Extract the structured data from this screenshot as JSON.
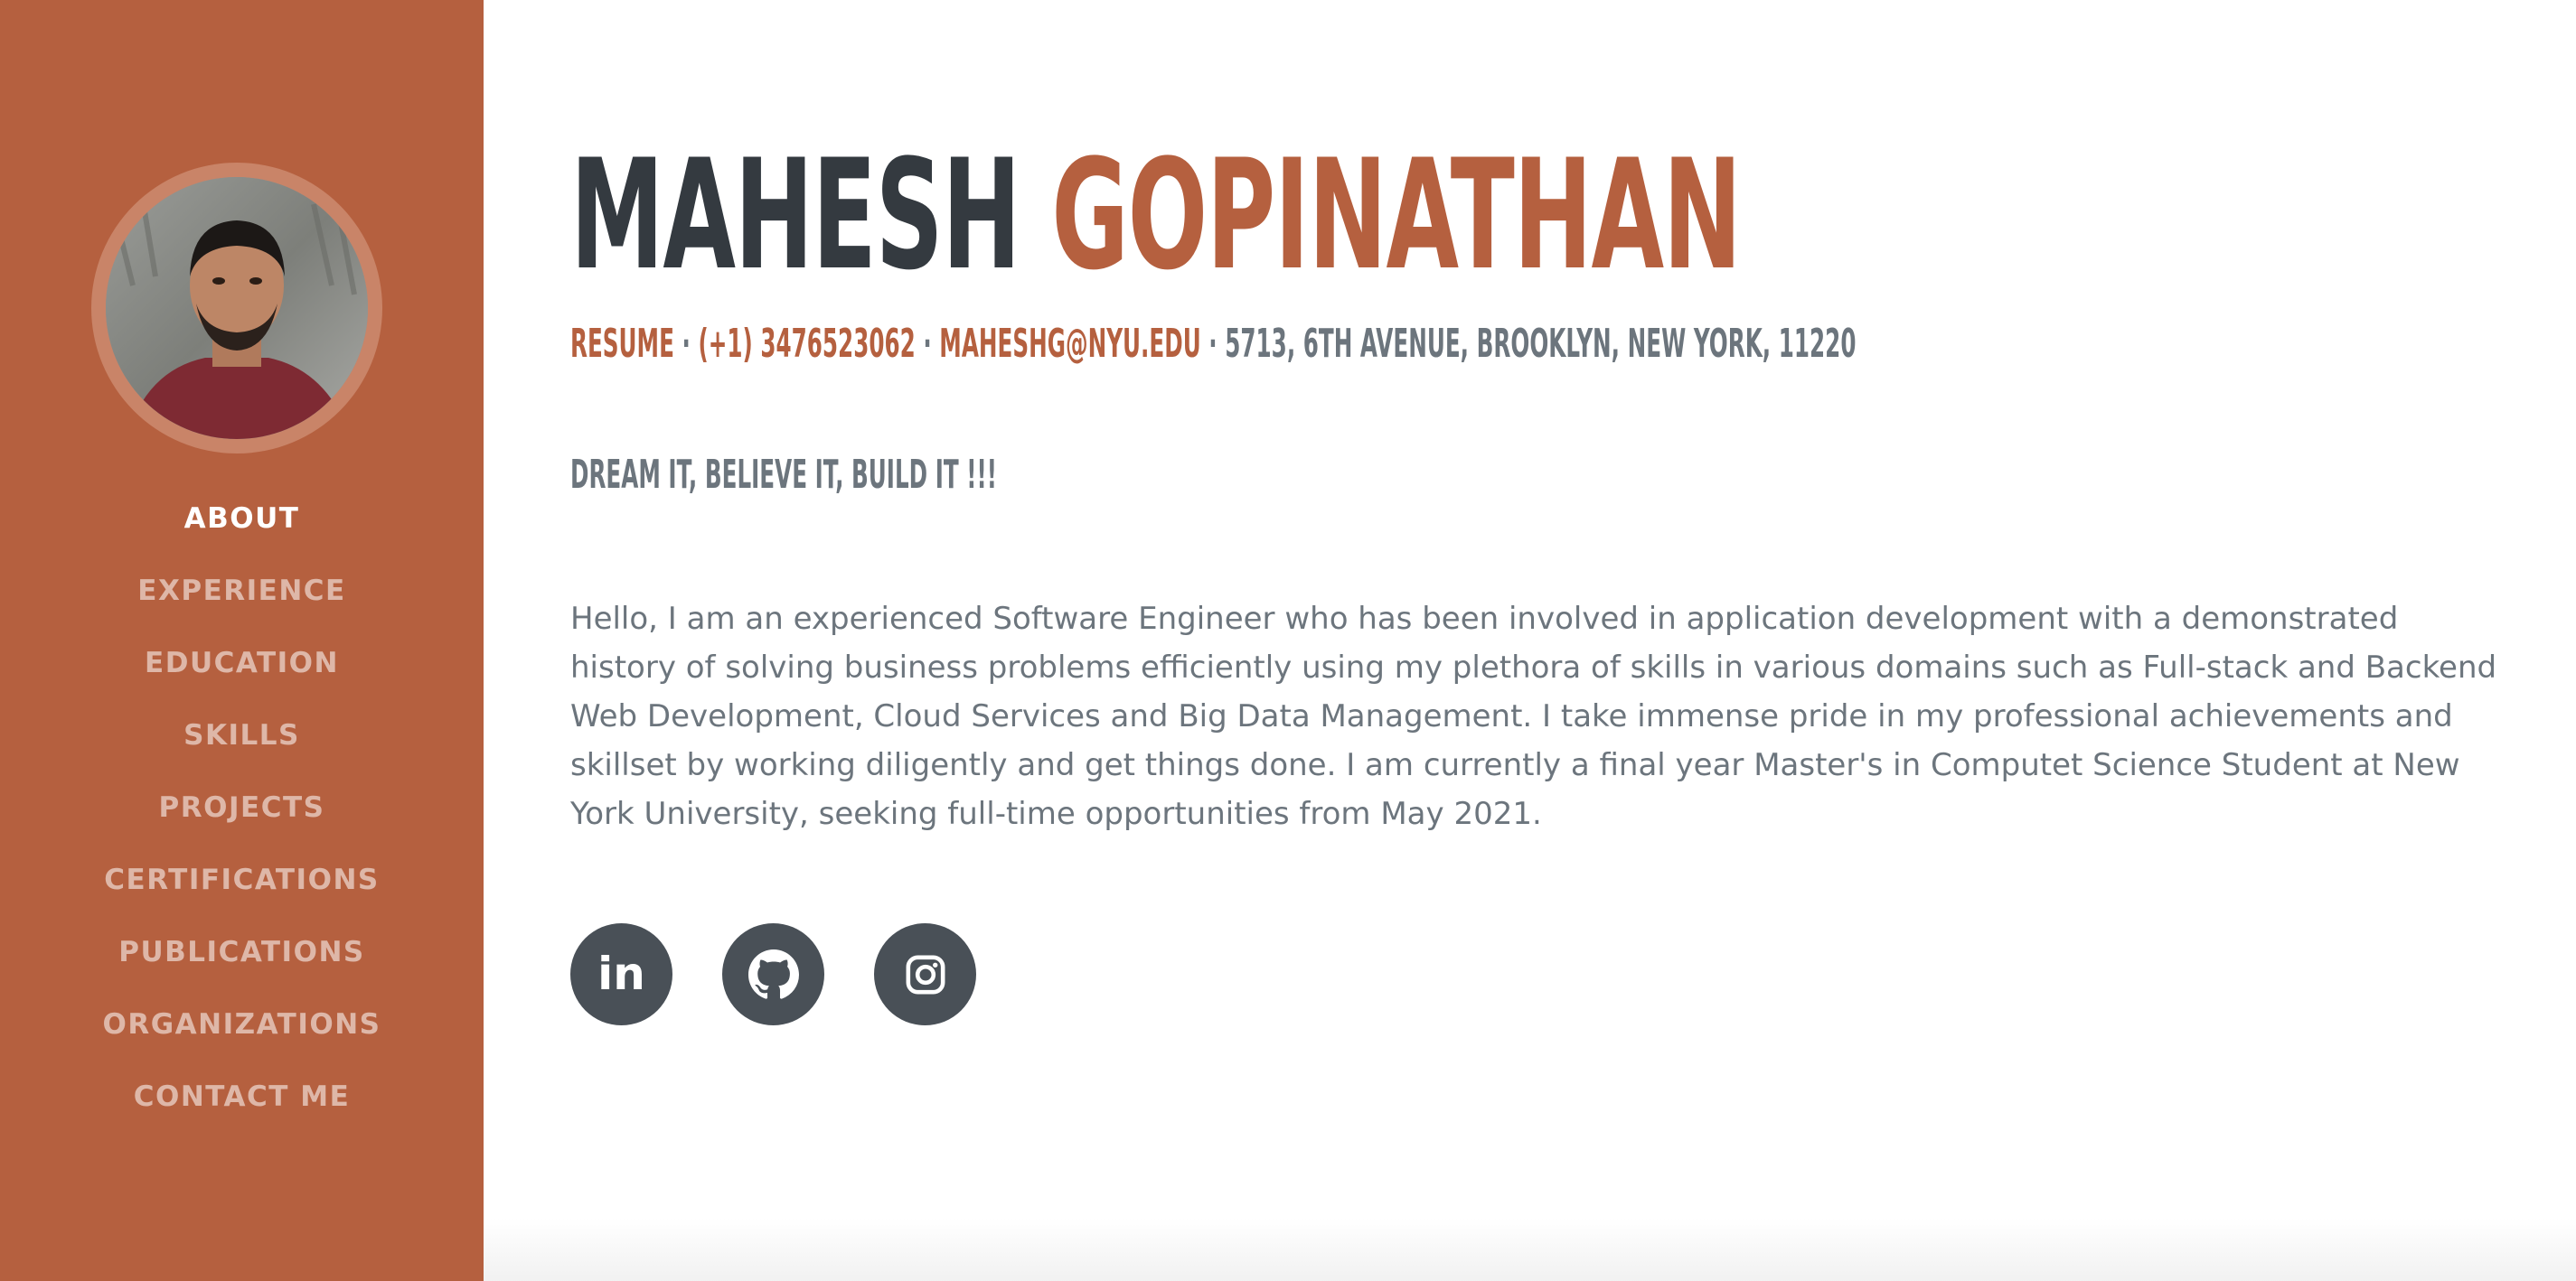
{
  "sidebar": {
    "accent_color": "#b5603f",
    "avatar_alt": "profile-photo",
    "nav": [
      {
        "label": "ABOUT",
        "active": true
      },
      {
        "label": "EXPERIENCE",
        "active": false
      },
      {
        "label": "EDUCATION",
        "active": false
      },
      {
        "label": "SKILLS",
        "active": false
      },
      {
        "label": "PROJECTS",
        "active": false
      },
      {
        "label": "CERTIFICATIONS",
        "active": false
      },
      {
        "label": "PUBLICATIONS",
        "active": false
      },
      {
        "label": "ORGANIZATIONS",
        "active": false
      },
      {
        "label": "CONTACT ME",
        "active": false
      }
    ]
  },
  "header": {
    "first_name": "MAHESH",
    "last_name": "GOPINATHAN",
    "resume": "RESUME",
    "phone": "(+1) 3476523062",
    "email": "MAHESHG@NYU.EDU",
    "address": "5713, 6TH AVENUE, BROOKLYN, NEW YORK, 11220",
    "separator": "·"
  },
  "tagline": "DREAM IT, BELIEVE IT, BUILD IT !!!",
  "bio": "Hello, I am an experienced Software Engineer who has been involved in application development with a demonstrated history of solving business problems efficiently using my plethora of skills in various domains such as Full-stack and Backend Web Development, Cloud Services and Big Data Management. I take immense pride in my professional achievements and skillset by working diligently and get things done. I am currently a final year Master's in Computet Science Student at New York University, seeking full-time opportunities from May 2021.",
  "social": {
    "linkedin_label": "in",
    "icons": [
      "linkedin-icon",
      "github-icon",
      "instagram-icon"
    ],
    "button_color": "#495057"
  },
  "colors": {
    "name_dark": "#343a40",
    "text_gray": "#6c757d"
  }
}
